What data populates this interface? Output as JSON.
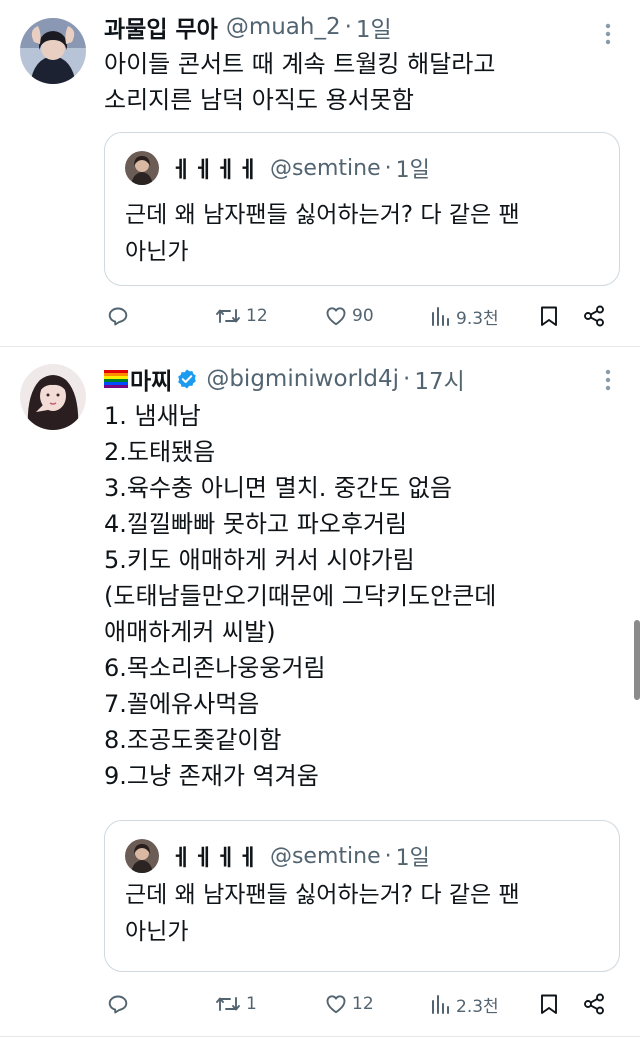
{
  "colors": {
    "text": "#0f1419",
    "secondary": "#536471",
    "border": "#cfd9de",
    "verified": "#1d9bf0"
  },
  "tweets": [
    {
      "display_name": "과물입 무아",
      "handle": "@muah_2",
      "separator": "·",
      "time": "1일",
      "body_lines": [
        "아이들 콘서트 때 계속 트월킹 해달라고",
        "소리지른 남덕 아직도 용서못함"
      ],
      "quote": {
        "display_name": "ㅔㅔㅔㅔ",
        "handle": "@semtine",
        "separator": "·",
        "time": "1일",
        "body_lines": [
          "근데 왜 남자팬들 싫어하는거? 다 같은 팬",
          "아닌가"
        ]
      },
      "actions": {
        "reply_icon": "reply-icon",
        "retweet_count": "12",
        "like_count": "90",
        "views_count": "9.3천",
        "bookmark_icon": "bookmark-icon",
        "share_icon": "share-icon"
      }
    },
    {
      "display_name": "마찌",
      "has_pride_flag": true,
      "verified": true,
      "handle": "@bigminiworld4j",
      "separator": "·",
      "time": "17시",
      "body_lines": [
        "1. 냄새남",
        "2.도태됐음",
        "3.육수충 아니면 멸치. 중간도 없음",
        "4.낄낄빠빠 못하고 파오후거림",
        "5.키도 애매하게 커서 시야가림",
        "(도태남들만오기때문에 그닥키도안큰데",
        "애매하게커 씨발)",
        "6.목소리존나웅웅거림",
        "7.꼴에유사먹음",
        "8.조공도좆같이함",
        "9.그냥 존재가 역겨움"
      ],
      "quote": {
        "display_name": "ㅔㅔㅔㅔ",
        "handle": "@semtine",
        "separator": "·",
        "time": "1일",
        "body_lines": [
          "근데 왜 남자팬들 싫어하는거? 다 같은 팬",
          "아닌가"
        ]
      },
      "actions": {
        "reply_icon": "reply-icon",
        "retweet_count": "1",
        "like_count": "12",
        "views_count": "2.3천",
        "bookmark_icon": "bookmark-icon",
        "share_icon": "share-icon"
      }
    }
  ]
}
